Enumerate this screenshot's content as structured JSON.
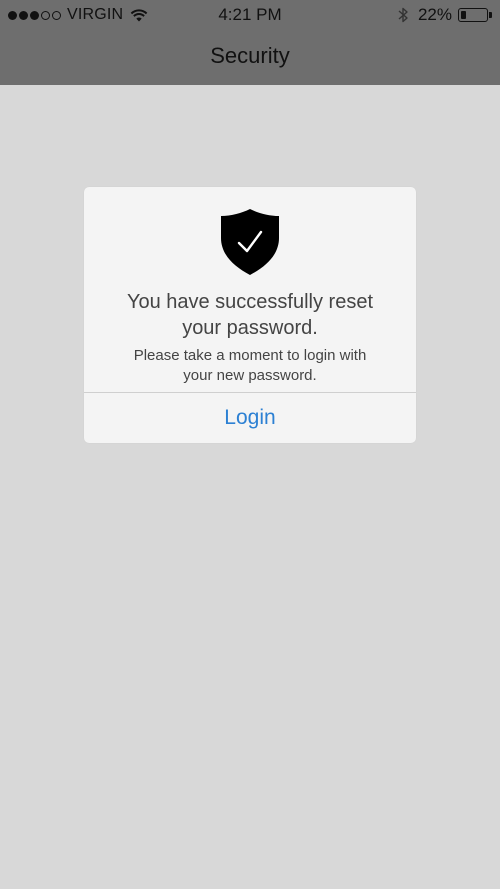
{
  "status_bar": {
    "signal_filled": 3,
    "signal_total": 5,
    "carrier": "VIRGIN",
    "wifi_icon": "wifi-icon",
    "time": "4:21 PM",
    "bluetooth_icon": "bluetooth-icon",
    "battery_percent_label": "22%",
    "battery_level": 0.22
  },
  "nav": {
    "title": "Security"
  },
  "dialog": {
    "icon": "shield-check-icon",
    "title_line1": "You have successfully reset",
    "title_line2": "your password.",
    "message_line1": "Please take a moment to login with",
    "message_line2": "your new password.",
    "login_label": "Login"
  },
  "colors": {
    "background": "#d8d8d8",
    "nav_bar": "#6e6e6e",
    "dialog_bg": "#f4f4f4",
    "accent": "#2c80d3",
    "text": "#444444"
  }
}
